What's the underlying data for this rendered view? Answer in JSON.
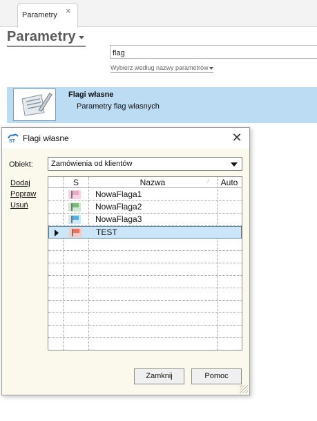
{
  "tab": {
    "label": "Parametry",
    "close_glyph": "×"
  },
  "page": {
    "title": "Parametry",
    "search_value": "flag",
    "filter_link": "Wybierz według nazwy parametrów"
  },
  "result": {
    "title": "Flagi własne",
    "subtitle": "Parametry flag własnych",
    "icon": "settings-document-icon"
  },
  "dialog": {
    "title": "Flagi własne",
    "app_icon": "app-logo-icon",
    "close_glyph": "✕",
    "obiekt_label": "Obiekt:",
    "obiekt_value": "Zamówienia od klientów",
    "actions": {
      "add": "Dodaj",
      "edit": "Popraw",
      "delete": "Usuń"
    },
    "grid": {
      "columns": [
        "S",
        "Nazwa",
        "Auto"
      ],
      "rows": [
        {
          "name": "NowaFlaga1",
          "flag_color": "#f0a6c8",
          "selected": false
        },
        {
          "name": "NowaFlaga2",
          "flag_color": "#6fbf6f",
          "selected": false
        },
        {
          "name": "NowaFlaga3",
          "flag_color": "#4fb3e8",
          "selected": false
        },
        {
          "name": "TEST",
          "flag_color": "#f07060",
          "selected": true
        }
      ],
      "empty_rows": 9
    },
    "buttons": {
      "close": "Zamknij",
      "help": "Pomoc"
    }
  },
  "colors": {
    "accent_selection": "#cbe6f8",
    "card_highlight": "#bcdcf3",
    "dialog_bg": "#fbf8ec"
  }
}
